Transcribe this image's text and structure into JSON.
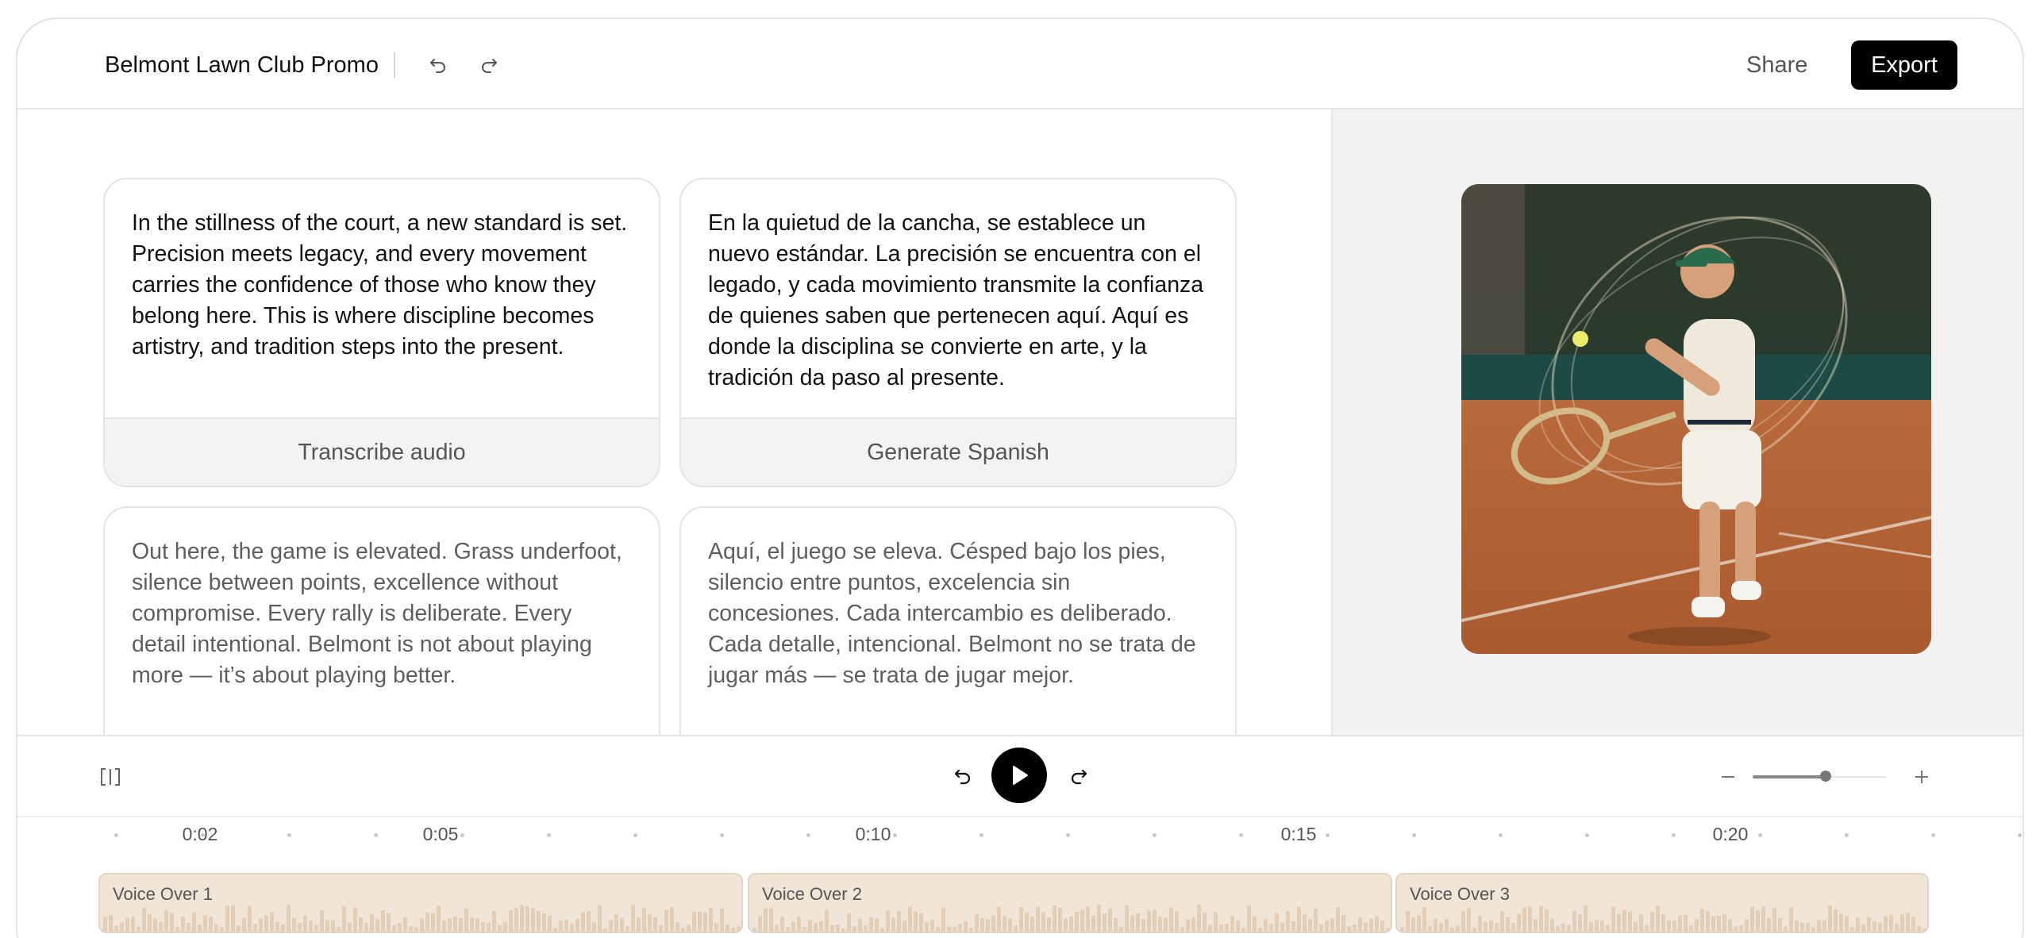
{
  "header": {
    "title": "Belmont Lawn Club Promo",
    "undo_icon": "undo-icon",
    "redo_icon": "redo-icon",
    "share_label": "Share",
    "export_label": "Export"
  },
  "cards": [
    {
      "text": "In the stillness of the court, a new standard is set. Precision meets legacy, and every movement carries the confidence of those who know they belong here. This is where discipline becomes artistry, and tradition steps into the present.",
      "action": "Transcribe audio"
    },
    {
      "text": "En la quietud de la cancha, se establece un nuevo estándar. La precisión se encuentra con el legado, y cada movimiento transmite la confianza de quienes saben que pertenecen aquí. Aquí es donde la disciplina se convierte en arte, y la tradición da paso al presente.",
      "action": "Generate Spanish"
    },
    {
      "text": "Out here, the game is elevated. Grass underfoot, silence between points, excellence without compromise. Every rally is deliberate. Every detail intentional. Belmont is not about playing more — it’s about playing better."
    },
    {
      "text": "Aquí, el juego se eleva. Césped bajo los pies, silencio entre puntos, excelencia sin concesiones. Cada intercambio es deliberado. Cada detalle, intencional. Belmont no se trata de jugar más — se trata de jugar mejor."
    }
  ],
  "preview": {
    "image": "tennis-player-forehand-illustration"
  },
  "playback": {
    "sidebar_toggle_icon": "split-panel-icon",
    "rewind_icon": "rewind-icon",
    "play_icon": "play-icon",
    "forward_icon": "forward-icon",
    "zoom_out_icon": "minus-icon",
    "zoom_in_icon": "plus-icon",
    "zoom_level": 0.55
  },
  "timeline": {
    "ticks": [
      "0:02",
      "0:05",
      "0:10",
      "0:15",
      "0:20"
    ],
    "clips": [
      "Voice Over 1",
      "Voice Over 2",
      "Voice Over 3"
    ]
  },
  "colors": {
    "accent": "#000000",
    "clip_fill": "#f1e5d8",
    "panel_bg": "#f3f2f0"
  }
}
